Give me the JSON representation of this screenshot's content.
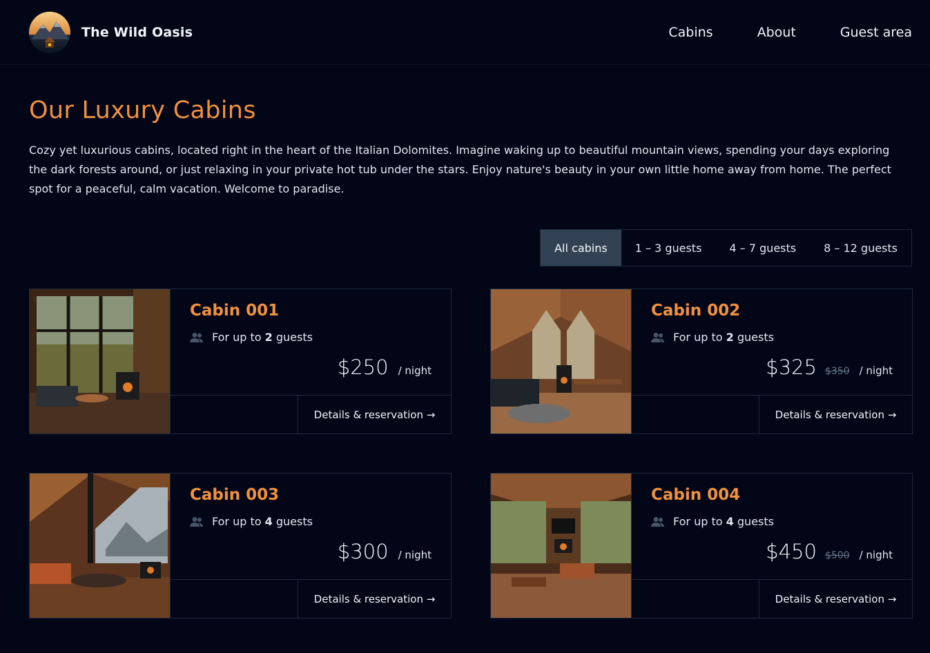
{
  "header": {
    "brand_name": "The Wild Oasis",
    "nav": [
      "Cabins",
      "About",
      "Guest area"
    ]
  },
  "main": {
    "title": "Our Luxury Cabins",
    "intro": "Cozy yet luxurious cabins, located right in the heart of the Italian Dolomites. Imagine waking up to beautiful mountain views, spending your days exploring the dark forests around, or just relaxing in your private hot tub under the stars. Enjoy nature's beauty in your own little home away from home. The perfect spot for a peaceful, calm vacation. Welcome to paradise.",
    "filters": [
      "All cabins",
      "1 – 3 guests",
      "4 – 7 guests",
      "8 – 12 guests"
    ],
    "active_filter": "All cabins"
  },
  "cabins": [
    {
      "name": "Cabin 001",
      "guests_prefix": "For up to",
      "guests": "2",
      "guests_suffix": "guests",
      "price": "$250",
      "old_price": "",
      "per_night": "/ night",
      "link": "Details & reservation →"
    },
    {
      "name": "Cabin 002",
      "guests_prefix": "For up to",
      "guests": "2",
      "guests_suffix": "guests",
      "price": "$325",
      "old_price": "$350",
      "per_night": "/ night",
      "link": "Details & reservation →"
    },
    {
      "name": "Cabin 003",
      "guests_prefix": "For up to",
      "guests": "4",
      "guests_suffix": "guests",
      "price": "$300",
      "old_price": "",
      "per_night": "/ night",
      "link": "Details & reservation →"
    },
    {
      "name": "Cabin 004",
      "guests_prefix": "For up to",
      "guests": "4",
      "guests_suffix": "guests",
      "price": "$450",
      "old_price": "$500",
      "per_night": "/ night",
      "link": "Details & reservation →"
    }
  ],
  "colors": {
    "background": "#020617",
    "accent": "#f0913e",
    "border": "#1e293b",
    "active_filter_bg": "#334155"
  }
}
